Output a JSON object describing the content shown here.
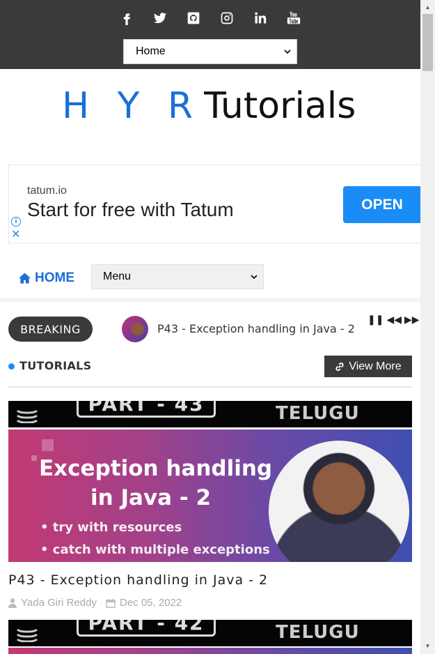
{
  "topbar": {
    "social_icons": [
      "facebook-icon",
      "twitter-icon",
      "github-icon",
      "instagram-icon",
      "linkedin-icon",
      "youtube-icon"
    ],
    "select_value": "Home"
  },
  "logo": {
    "part1": "H Y R",
    "part2": "Tutorials"
  },
  "ad": {
    "domain": "tatum.io",
    "headline": "Start for free with Tatum",
    "cta": "OPEN"
  },
  "nav": {
    "home_label": "HOME",
    "menu_value": "Menu"
  },
  "breaking": {
    "label": "BREAKING",
    "headline": "P43 - Exception handling in Java - 2"
  },
  "section": {
    "title": "TUTORIALS",
    "view_more": "View More"
  },
  "posts": [
    {
      "thumb_part": "PART - 43",
      "thumb_lang": "TELUGU",
      "hero_line1": "Exception handling",
      "hero_line2": "in Java - 2",
      "hero_bullet1": "• try with resources",
      "hero_bullet2": "• catch with multiple exceptions",
      "title": "P43 - Exception handling in Java - 2",
      "author": "Yada Giri Reddy",
      "date": "Dec 05, 2022"
    },
    {
      "thumb_part": "PART - 42",
      "thumb_lang": "TELUGU"
    }
  ],
  "colors": {
    "topbar": "#3a3a3a",
    "accent": "#1a6fd6",
    "ad_button": "#1a8cf5"
  }
}
